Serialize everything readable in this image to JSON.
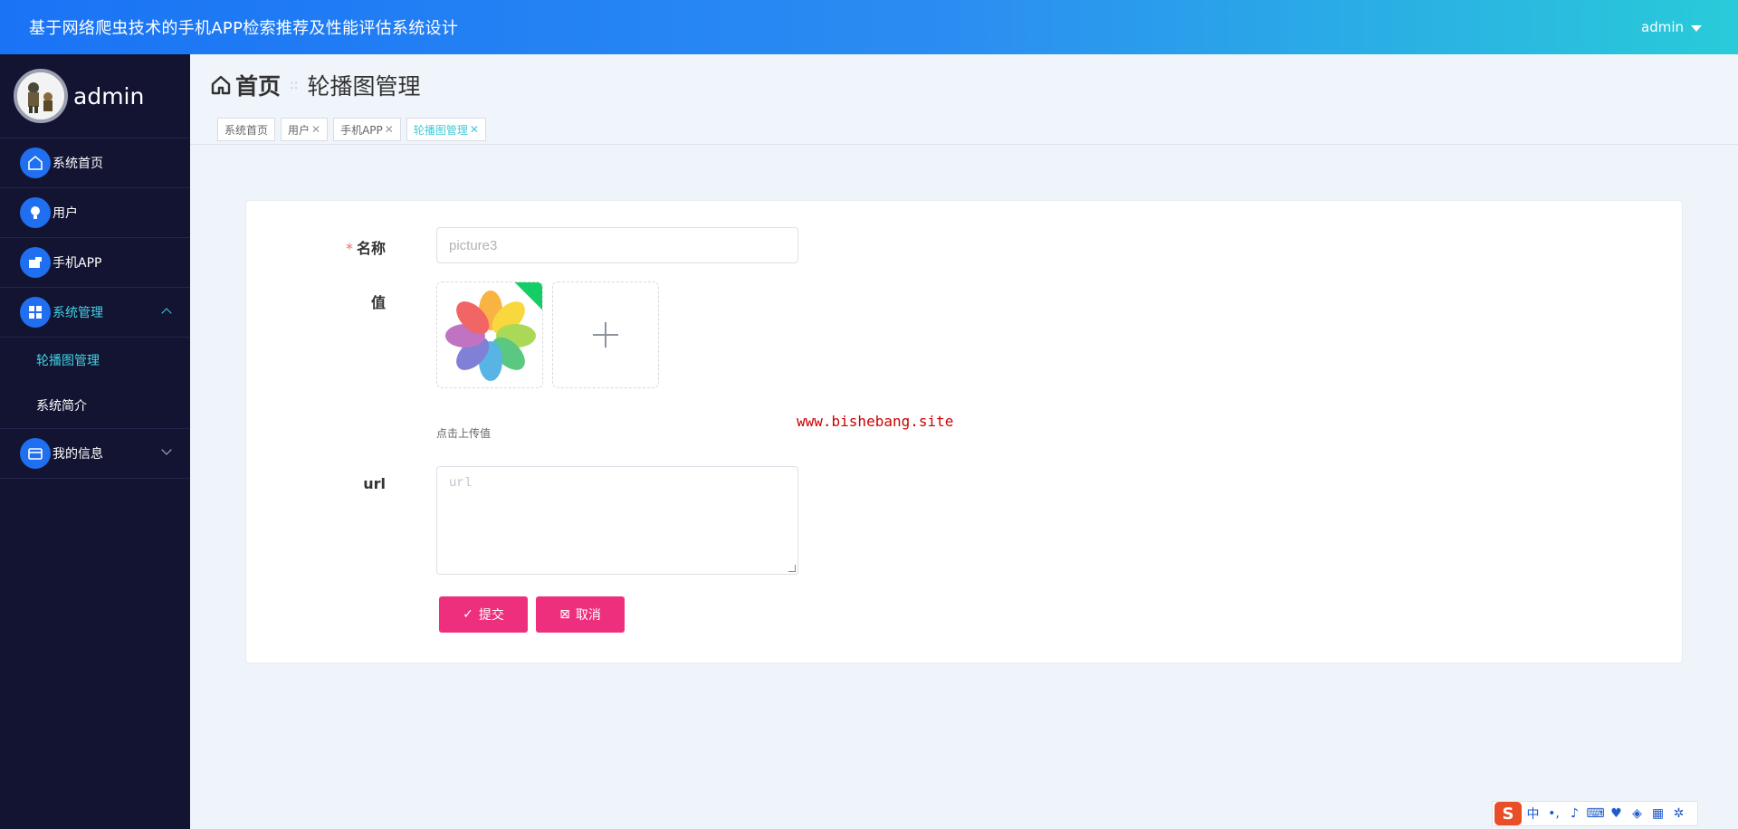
{
  "header": {
    "title": "基于网络爬虫技术的手机APP检索推荐及性能评估系统设计",
    "user": "admin"
  },
  "sidebar": {
    "profile_name": "admin",
    "items": [
      {
        "label": "系统首页",
        "icon": "home-icon"
      },
      {
        "label": "用户",
        "icon": "bulb-icon"
      },
      {
        "label": "手机APP",
        "icon": "camera-icon"
      },
      {
        "label": "系统管理",
        "icon": "grid-icon",
        "children": [
          "轮播图管理",
          "系统简介"
        ],
        "active_child": "轮播图管理"
      },
      {
        "label": "我的信息",
        "icon": "wallet-icon"
      }
    ]
  },
  "breadcrumb": {
    "home": "首页",
    "current": "轮播图管理"
  },
  "tags": [
    {
      "label": "系统首页",
      "closable": false
    },
    {
      "label": "用户",
      "closable": true
    },
    {
      "label": "手机APP",
      "closable": true
    },
    {
      "label": "轮播图管理",
      "closable": true,
      "active": true
    }
  ],
  "form": {
    "name_label": "名称",
    "name_value": "picture3",
    "value_label": "值",
    "upload_hint": "点击上传值",
    "url_label": "url",
    "url_placeholder": "url",
    "submit_label": "提交",
    "cancel_label": "取消"
  },
  "watermark": "www.bishebang.site",
  "ime": {
    "logo": "S",
    "lang": "中"
  },
  "colors": {
    "accent": "#41d2e2",
    "button": "#ee2f7d",
    "sidebar": "#121432",
    "header_start": "#1a73f5",
    "header_end": "#29cbd9"
  }
}
